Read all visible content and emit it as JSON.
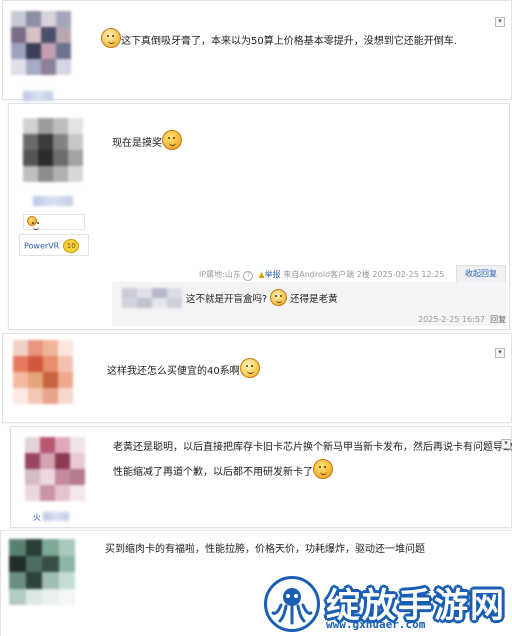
{
  "colors": {
    "link_blue": "#2d64b3",
    "meta_gray": "#999999",
    "logo_blue": "#1a5fb4"
  },
  "posts": [
    {
      "text": "这下真倒吸牙膏了，本来以为50算上价格基本零提升，没想到它还能开倒车."
    },
    {
      "text": "现在是摸奖",
      "badge": {
        "label": "PowerVR",
        "level": "10"
      },
      "meta": {
        "ip": "IP属地:山东",
        "report": "举报",
        "source": "来自Android客户端",
        "floor": "2楼",
        "time": "2025-02-25 12:25",
        "collapse": "收起回复"
      },
      "reply": {
        "text_a": "这不就是开盲盒吗?",
        "text_b": "还得是老黄",
        "time": "2025-2-25 16:57",
        "action": "回复"
      }
    },
    {
      "text": "这样我还怎么买便宜的40系啊"
    },
    {
      "line1": "老黄还是聪明，以后直接把库存卡旧卡芯片换个新马甲当新卡发布，然后再说卡有问题导致",
      "line2": "性能缩减了再道个歉，以后都不用研发新卡了",
      "username": "火"
    },
    {
      "text": "买到缩肉卡的有福啦，性能拉胯，价格天价，功耗爆炸，驱动还一堆问题"
    }
  ],
  "watermark": {
    "site_name": "绽放手游网",
    "url": "www.gxhuaer.com",
    "icon": "octopus-logo-icon"
  }
}
